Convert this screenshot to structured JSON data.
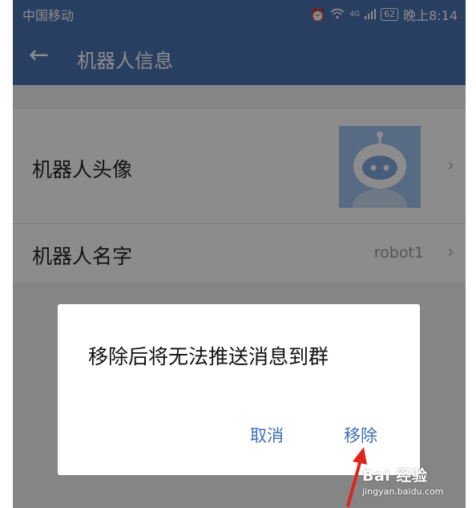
{
  "status_bar": {
    "carrier": "中国移动",
    "network": "4G",
    "battery": "62",
    "time": "晚上8:14"
  },
  "header": {
    "title": "机器人信息"
  },
  "settings": {
    "avatar_label": "机器人头像",
    "name_label": "机器人名字",
    "name_value": "robot1"
  },
  "dialog": {
    "message": "移除后将无法推送消息到群",
    "cancel": "取消",
    "remove": "移除"
  },
  "watermark": {
    "brand": "Bai 经验",
    "url": "jingyan.baidu.com"
  },
  "colors": {
    "header": "#4a73b3",
    "dialog_button": "#3d6fb5",
    "annotation_arrow": "#e0231b",
    "avatar_bg": "#9ec3f0"
  },
  "icons": {
    "back": "back-arrow-icon",
    "chevron": "chevron-right-icon",
    "alarm": "alarm-icon",
    "wifi": "wifi-icon",
    "signal": "signal-icon"
  }
}
